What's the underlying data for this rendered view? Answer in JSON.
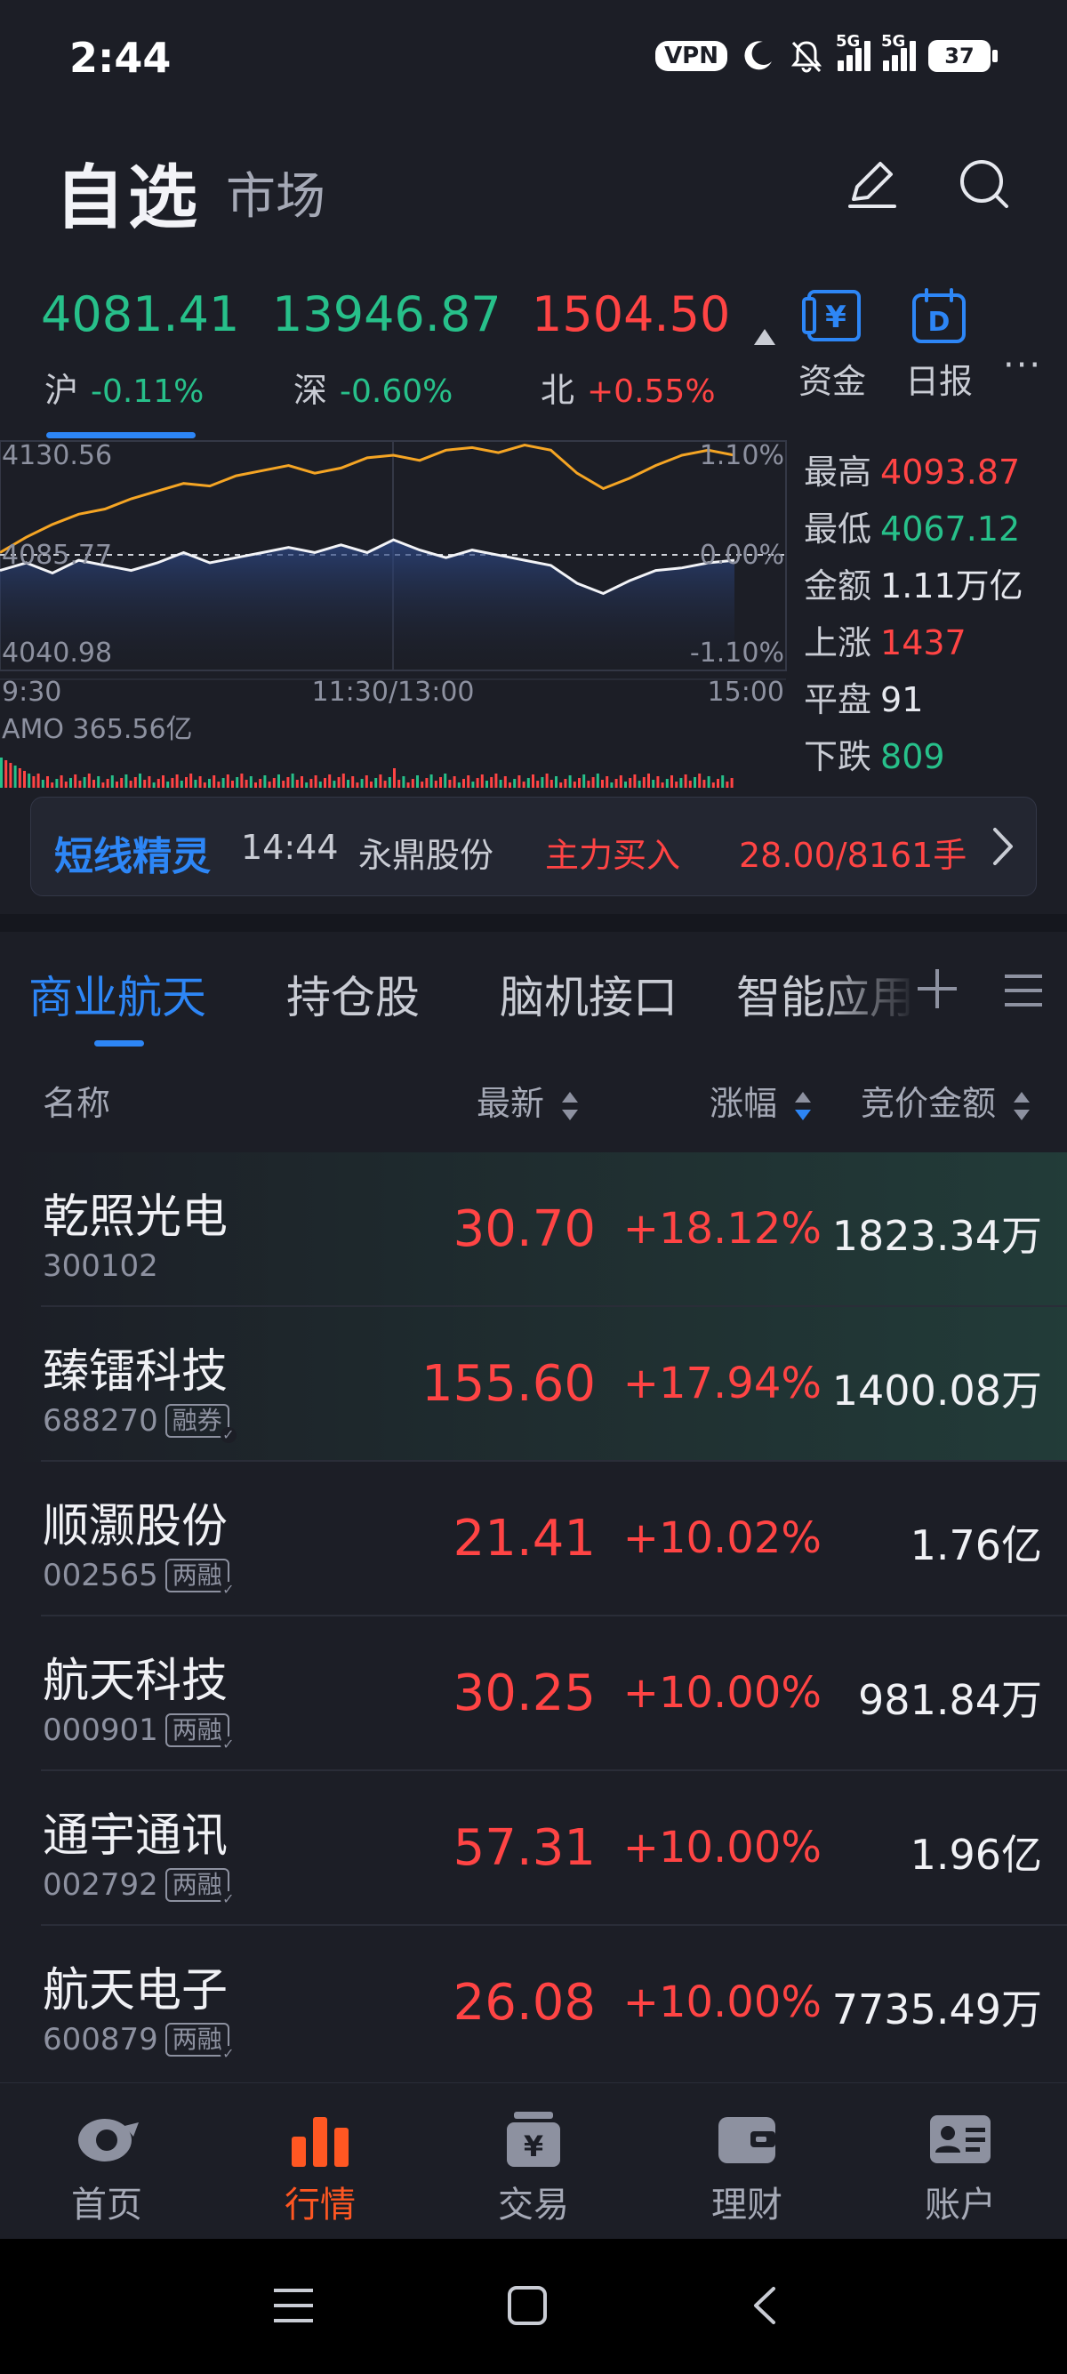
{
  "status": {
    "time": "2:44",
    "vpn": "VPN",
    "net1": "5G",
    "net2": "5G",
    "battery": "37"
  },
  "header": {
    "title": "自选",
    "subtitle": "市场"
  },
  "indices": [
    {
      "value": "4081.41",
      "label": "沪",
      "pct": "-0.11%"
    },
    {
      "value": "13946.87",
      "label": "深",
      "pct": "-0.60%"
    },
    {
      "value": "1504.50",
      "label": "北",
      "pct": "+0.55%"
    }
  ],
  "tools": {
    "fund_label": "资金",
    "daily_label": "日报",
    "daily_icon_letter": "D",
    "fund_icon_letter": "¥"
  },
  "chart": {
    "y_top": "4130.56",
    "y_mid": "4085.77",
    "y_bot": "4040.98",
    "pct_top": "1.10%",
    "pct_mid": "0.00%",
    "pct_bot": "-1.10%",
    "t_start": "9:30",
    "t_mid": "11:30/13:00",
    "t_end": "15:00",
    "amo": "AMO 365.56亿"
  },
  "chart_data": {
    "type": "line",
    "x": [
      "9:30",
      "11:30/13:00",
      "15:00"
    ],
    "ylim": [
      4040.98,
      4130.56
    ],
    "series": [
      {
        "values": [
          4087,
          4093,
          4098,
          4102,
          4104,
          4108,
          4111,
          4114,
          4113,
          4117,
          4119,
          4121,
          4118,
          4120,
          4124,
          4125,
          4123,
          4127,
          4128,
          4126,
          4129,
          4127,
          4118,
          4112,
          4116,
          4121,
          4125,
          4127,
          4125
        ],
        "color": "#f5a524"
      },
      {
        "values": [
          4080,
          4083,
          4079,
          4084,
          4082,
          4080,
          4083,
          4087,
          4083,
          4085,
          4087,
          4089,
          4087,
          4090,
          4087,
          4092,
          4088,
          4085,
          4088,
          4086,
          4084,
          4082,
          4075,
          4071,
          4076,
          4080,
          4081,
          4083,
          4084
        ],
        "color": "#f2f3f7"
      }
    ]
  },
  "stats": [
    {
      "key": "最高",
      "value": "4093.87",
      "tone": "red"
    },
    {
      "key": "最低",
      "value": "4067.12",
      "tone": "green"
    },
    {
      "key": "金额",
      "value": "1.11万亿",
      "tone": "white"
    },
    {
      "key": "上涨",
      "value": "1437",
      "tone": "red"
    },
    {
      "key": "平盘",
      "value": "91",
      "tone": "white"
    },
    {
      "key": "下跌",
      "value": "809",
      "tone": "green"
    }
  ],
  "ticker": {
    "brand": "短线精灵",
    "time": "14:44",
    "stock": "永鼎股份",
    "signal": "主力买入",
    "detail": "28.00/8161手"
  },
  "tabs": [
    {
      "label": "商业航天"
    },
    {
      "label": "持仓股"
    },
    {
      "label": "脑机接口"
    },
    {
      "label": "智能应用"
    }
  ],
  "columns": {
    "name": "名称",
    "latest": "最新",
    "change": "涨幅",
    "auction": "竞价金额"
  },
  "rows": [
    {
      "name": "乾照光电",
      "code": "300102",
      "badge": "",
      "price": "30.70",
      "change": "+18.12%",
      "amount": "1823.34万"
    },
    {
      "name": "臻镭科技",
      "code": "688270",
      "badge": "融券",
      "price": "155.60",
      "change": "+17.94%",
      "amount": "1400.08万"
    },
    {
      "name": "顺灏股份",
      "code": "002565",
      "badge": "两融",
      "price": "21.41",
      "change": "+10.02%",
      "amount": "1.76亿"
    },
    {
      "name": "航天科技",
      "code": "000901",
      "badge": "两融",
      "price": "30.25",
      "change": "+10.00%",
      "amount": "981.84万"
    },
    {
      "name": "通宇通讯",
      "code": "002792",
      "badge": "两融",
      "price": "57.31",
      "change": "+10.00%",
      "amount": "1.96亿"
    },
    {
      "name": "航天电子",
      "code": "600879",
      "badge": "两融",
      "price": "26.08",
      "change": "+10.00%",
      "amount": "7735.49万"
    }
  ],
  "nav": [
    {
      "label": "首页",
      "icon": "home-icon"
    },
    {
      "label": "行情",
      "icon": "market-chart-icon"
    },
    {
      "label": "交易",
      "icon": "trade-icon"
    },
    {
      "label": "理财",
      "icon": "wallet-icon"
    },
    {
      "label": "账户",
      "icon": "account-card-icon"
    }
  ],
  "colors": {
    "up": "#ff4444",
    "down": "#27c08a",
    "accent": "#2d86f6",
    "nav_active": "#ff5722",
    "background": "#1c1e26"
  }
}
